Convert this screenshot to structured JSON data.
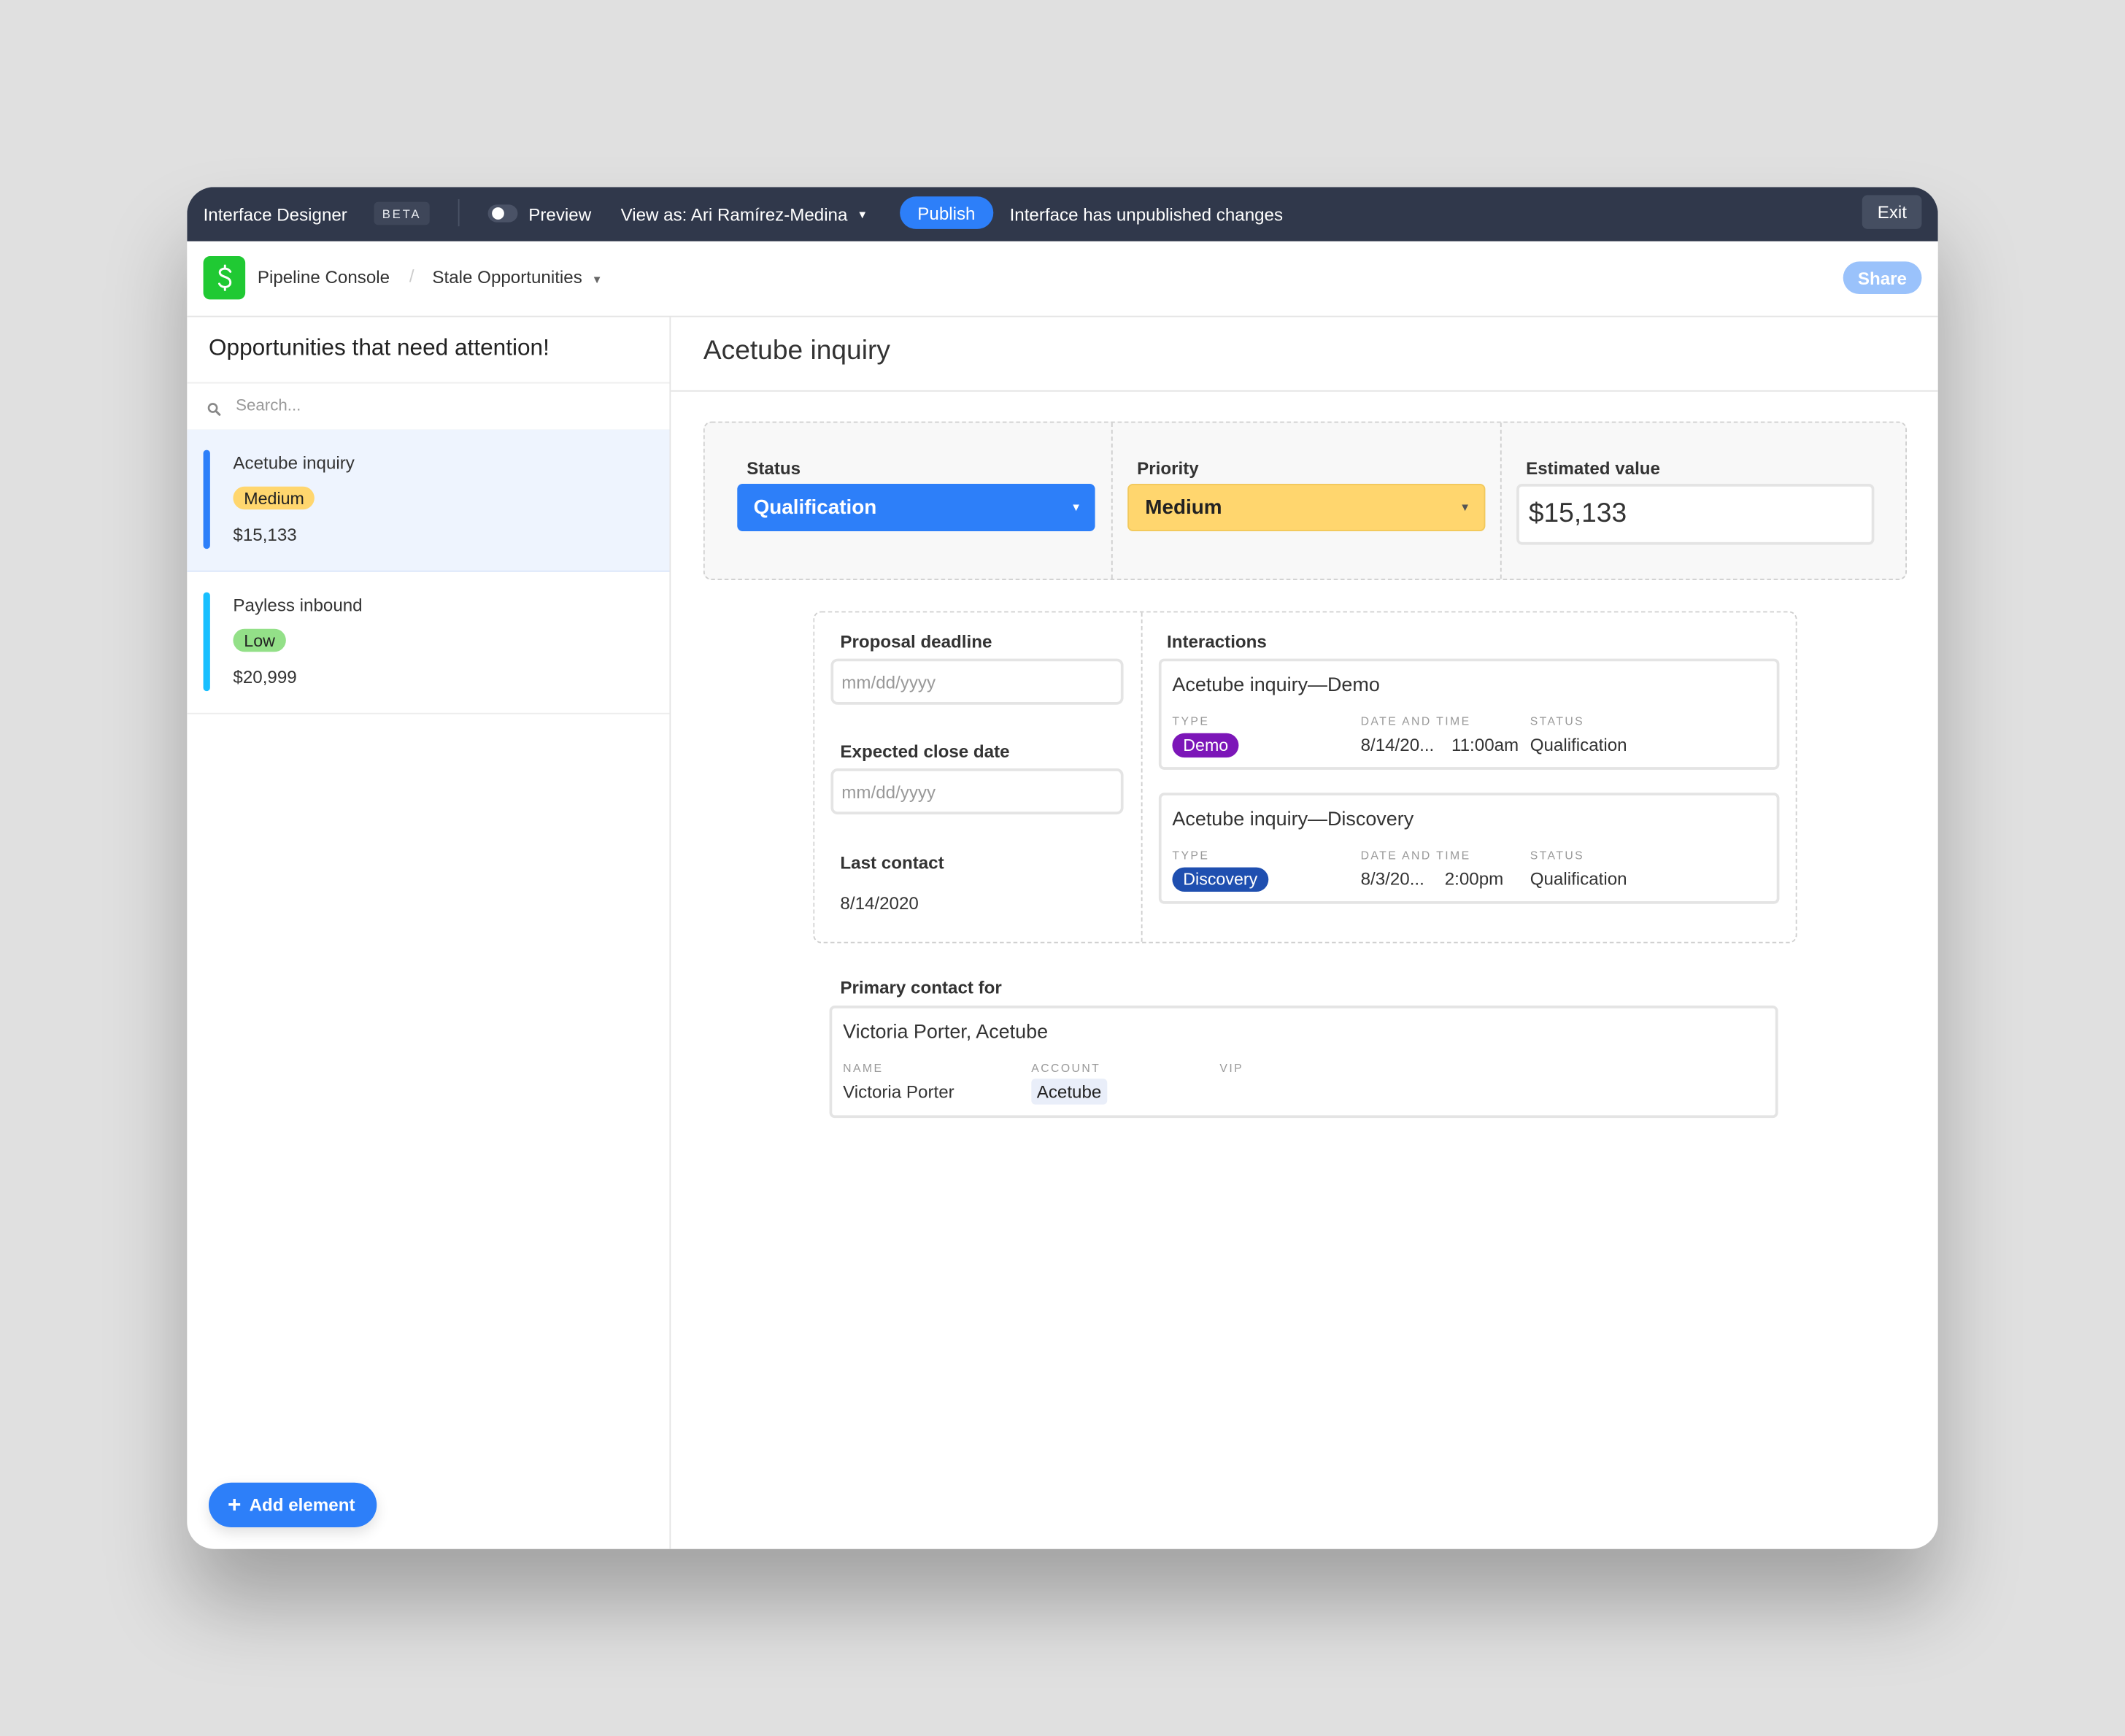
{
  "topbar": {
    "title": "Interface Designer",
    "beta_badge": "BETA",
    "preview_label": "Preview",
    "view_as": "View as: Ari Ramírez-Medina",
    "publish_label": "Publish",
    "status_text": "Interface has unpublished changes",
    "exit_label": "Exit"
  },
  "header": {
    "app_name": "Pipeline Console",
    "separator": "/",
    "page_name": "Stale Opportunities",
    "share_label": "Share",
    "logo_glyph": "$"
  },
  "sidebar": {
    "title": "Opportunities that need attention!",
    "search_placeholder": "Search...",
    "items": [
      {
        "name": "Acetube inquiry",
        "priority": "Medium",
        "amount": "$15,133",
        "bar_color": "#2d7ff9",
        "pill_color": "#ffd66e",
        "selected": true
      },
      {
        "name": "Payless inbound",
        "priority": "Low",
        "amount": "$20,999",
        "bar_color": "#18bfff",
        "pill_color": "#93e088",
        "selected": false
      }
    ],
    "add_element_label": "Add element"
  },
  "detail": {
    "title": "Acetube inquiry",
    "status": {
      "label": "Status",
      "value": "Qualification",
      "color": "#2d7ff9"
    },
    "priority": {
      "label": "Priority",
      "value": "Medium",
      "color": "#ffd66e"
    },
    "estimated_value": {
      "label": "Estimated value",
      "value": "$15,133"
    },
    "proposal_deadline": {
      "label": "Proposal deadline",
      "placeholder": "mm/dd/yyyy"
    },
    "expected_close_date": {
      "label": "Expected close date",
      "placeholder": "mm/dd/yyyy"
    },
    "last_contact": {
      "label": "Last contact",
      "value": "8/14/2020"
    },
    "interactions": {
      "label": "Interactions",
      "columns": [
        "TYPE",
        "DATE AND TIME",
        "STATUS"
      ],
      "records": [
        {
          "title": "Acetube inquiry—Demo",
          "type": "Demo",
          "type_color": "#7c16b8",
          "date": "8/14/20...",
          "time": "11:00am",
          "status": "Qualification"
        },
        {
          "title": "Acetube inquiry—Discovery",
          "type": "Discovery",
          "type_color": "#1f4fb0",
          "date": "8/3/20...",
          "time": "2:00pm",
          "status": "Qualification"
        }
      ]
    },
    "primary_contact": {
      "label": "Primary contact for",
      "title": "Victoria Porter, Acetube",
      "columns": [
        "NAME",
        "ACCOUNT",
        "VIP"
      ],
      "name": "Victoria Porter",
      "account": "Acetube",
      "vip": ""
    }
  }
}
